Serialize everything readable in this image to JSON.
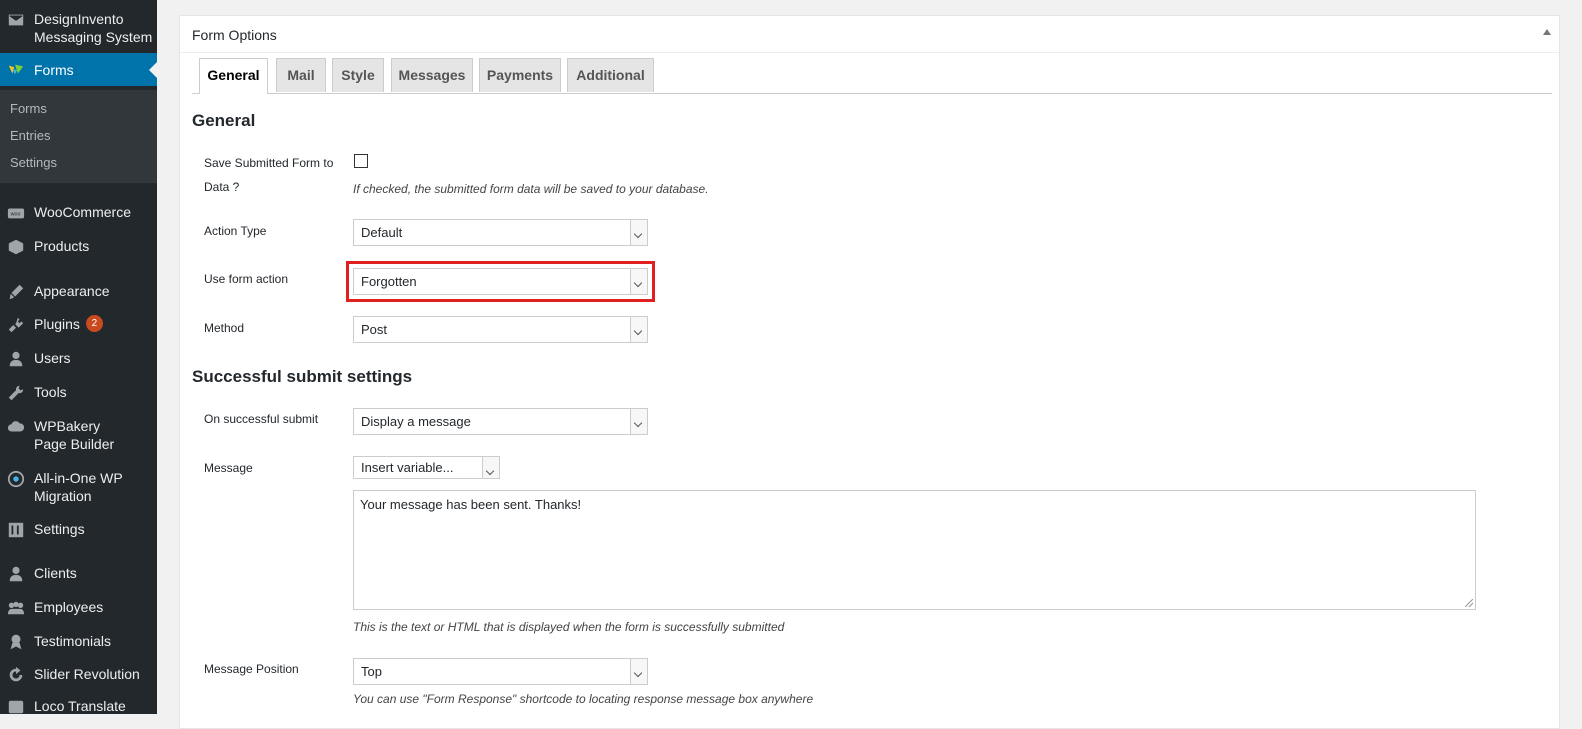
{
  "sidebar": {
    "brand": {
      "label": "DesignInvento Messaging System",
      "icon": "mail-icon"
    },
    "active": {
      "label": "Forms",
      "icon": "forms-icon"
    },
    "submenu": [
      "Forms",
      "Entries",
      "Settings"
    ],
    "items": [
      {
        "label": "WooCommerce",
        "icon": "woo-icon"
      },
      {
        "label": "Products",
        "icon": "box-icon"
      },
      {
        "label": "Appearance",
        "icon": "brush-icon"
      },
      {
        "label": "Plugins",
        "icon": "plug-icon",
        "badge": "2"
      },
      {
        "label": "Users",
        "icon": "user-icon"
      },
      {
        "label": "Tools",
        "icon": "wrench-icon"
      },
      {
        "label": "WPBakery Page Builder",
        "icon": "cloud-icon"
      },
      {
        "label": "All-in-One WP Migration",
        "icon": "migration-icon"
      },
      {
        "label": "Settings",
        "icon": "sliders-icon"
      },
      {
        "label": "Clients",
        "icon": "clients-icon"
      },
      {
        "label": "Employees",
        "icon": "group-icon"
      },
      {
        "label": "Testimonials",
        "icon": "award-icon"
      },
      {
        "label": "Slider Revolution",
        "icon": "refresh-icon"
      },
      {
        "label": "Loco Translate",
        "icon": "translate-icon"
      }
    ]
  },
  "panel": {
    "title": "Form Options",
    "tabs": [
      "General",
      "Mail",
      "Style",
      "Messages",
      "Payments",
      "Additional"
    ],
    "active_tab": "General"
  },
  "general": {
    "heading": "General",
    "save_label": "Save Submitted Form to Data ?",
    "save_desc": "If checked, the submitted form data will be saved to your database.",
    "action_type_label": "Action Type",
    "action_type_value": "Default",
    "use_form_action_label": "Use form action",
    "use_form_action_value": "Forgotten",
    "method_label": "Method",
    "method_value": "Post"
  },
  "success": {
    "heading": "Successful submit settings",
    "on_submit_label": "On successful submit",
    "on_submit_value": "Display a message",
    "message_label": "Message",
    "insert_variable": "Insert variable...",
    "message_text": "Your message has been sent. Thanks!",
    "message_desc": "This is the text or HTML that is displayed when the form is successfully submitted",
    "position_label": "Message Position",
    "position_value": "Top",
    "position_desc": "You can use \"Form Response\" shortcode to locating response message box anywhere"
  },
  "colors": {
    "sidebar_bg": "#23282d",
    "accent": "#0073aa",
    "highlight": "#e02020",
    "badge": "#ca4a1f"
  }
}
